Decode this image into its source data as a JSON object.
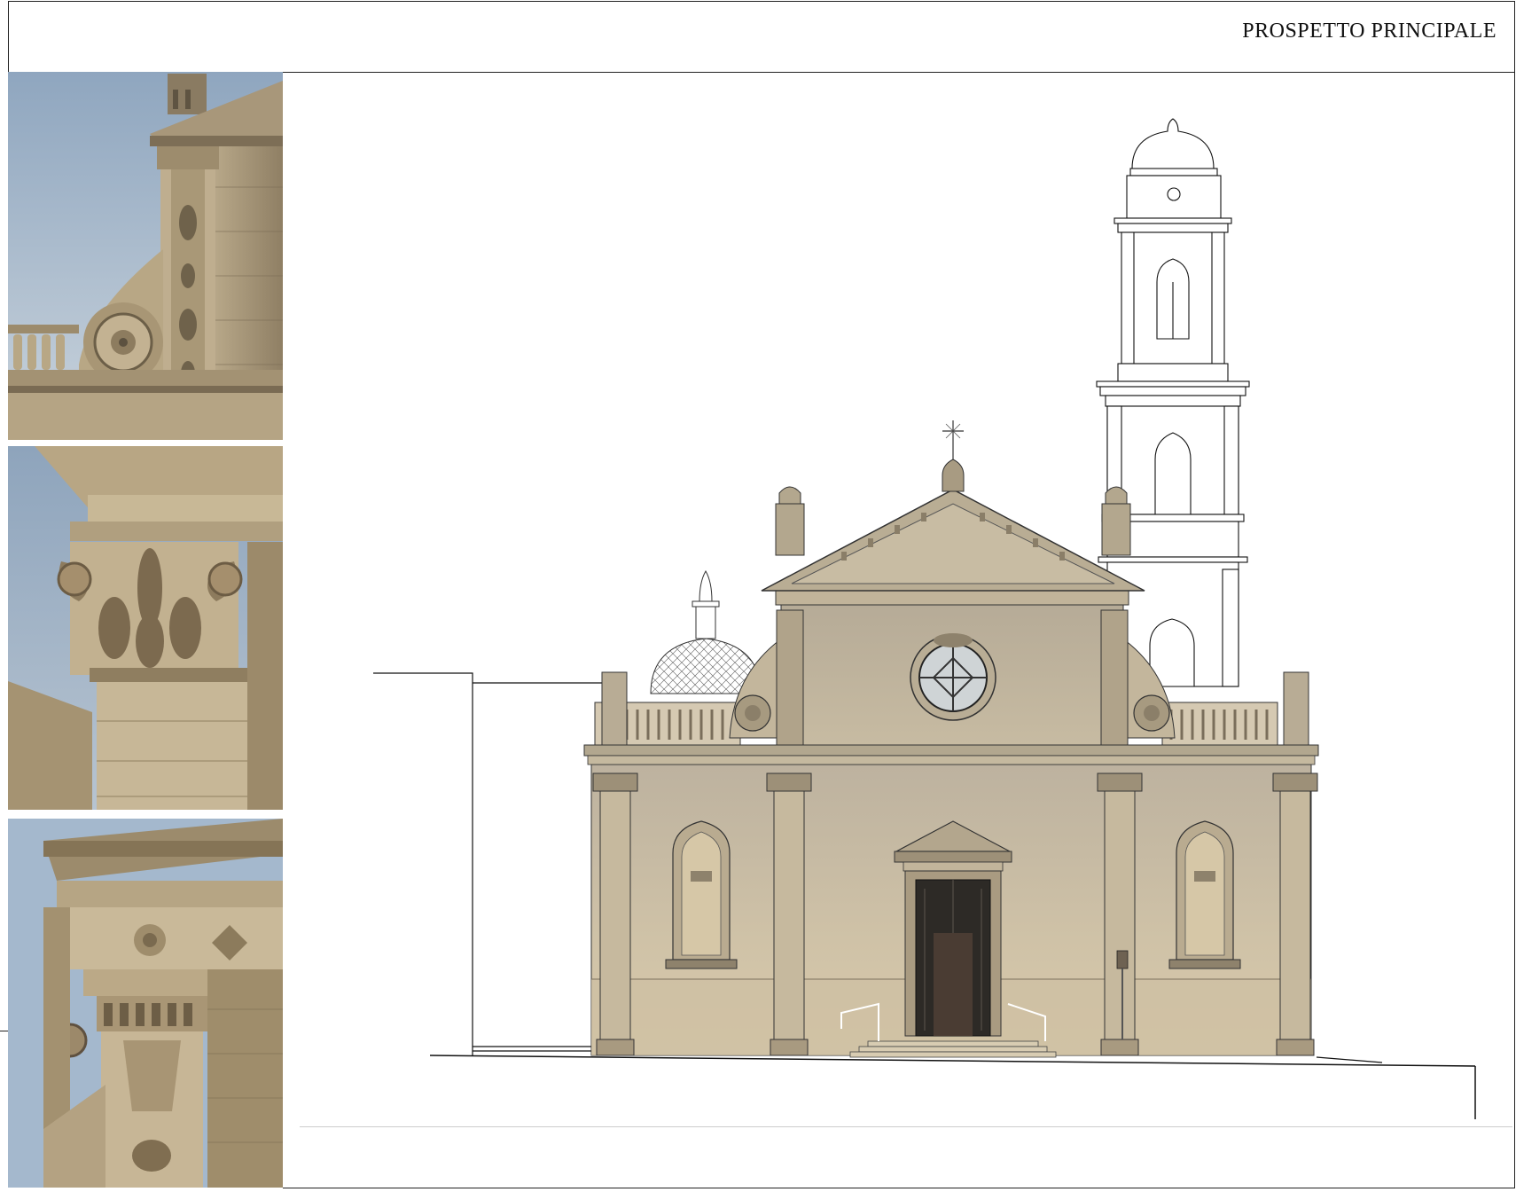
{
  "sheet": {
    "title": "PROSPETTO PRINCIPALE"
  },
  "photos": [
    {
      "subject": "scroll-volute-and-pilaster-detail"
    },
    {
      "subject": "corinthian-capital-detail"
    },
    {
      "subject": "cornice-and-pilaster-capital-detail"
    }
  ],
  "colors": {
    "stone": "#c9b99a",
    "stone_dark": "#8c7a5d",
    "sky": "#9fb3c8",
    "line": "#1a1a1a"
  }
}
